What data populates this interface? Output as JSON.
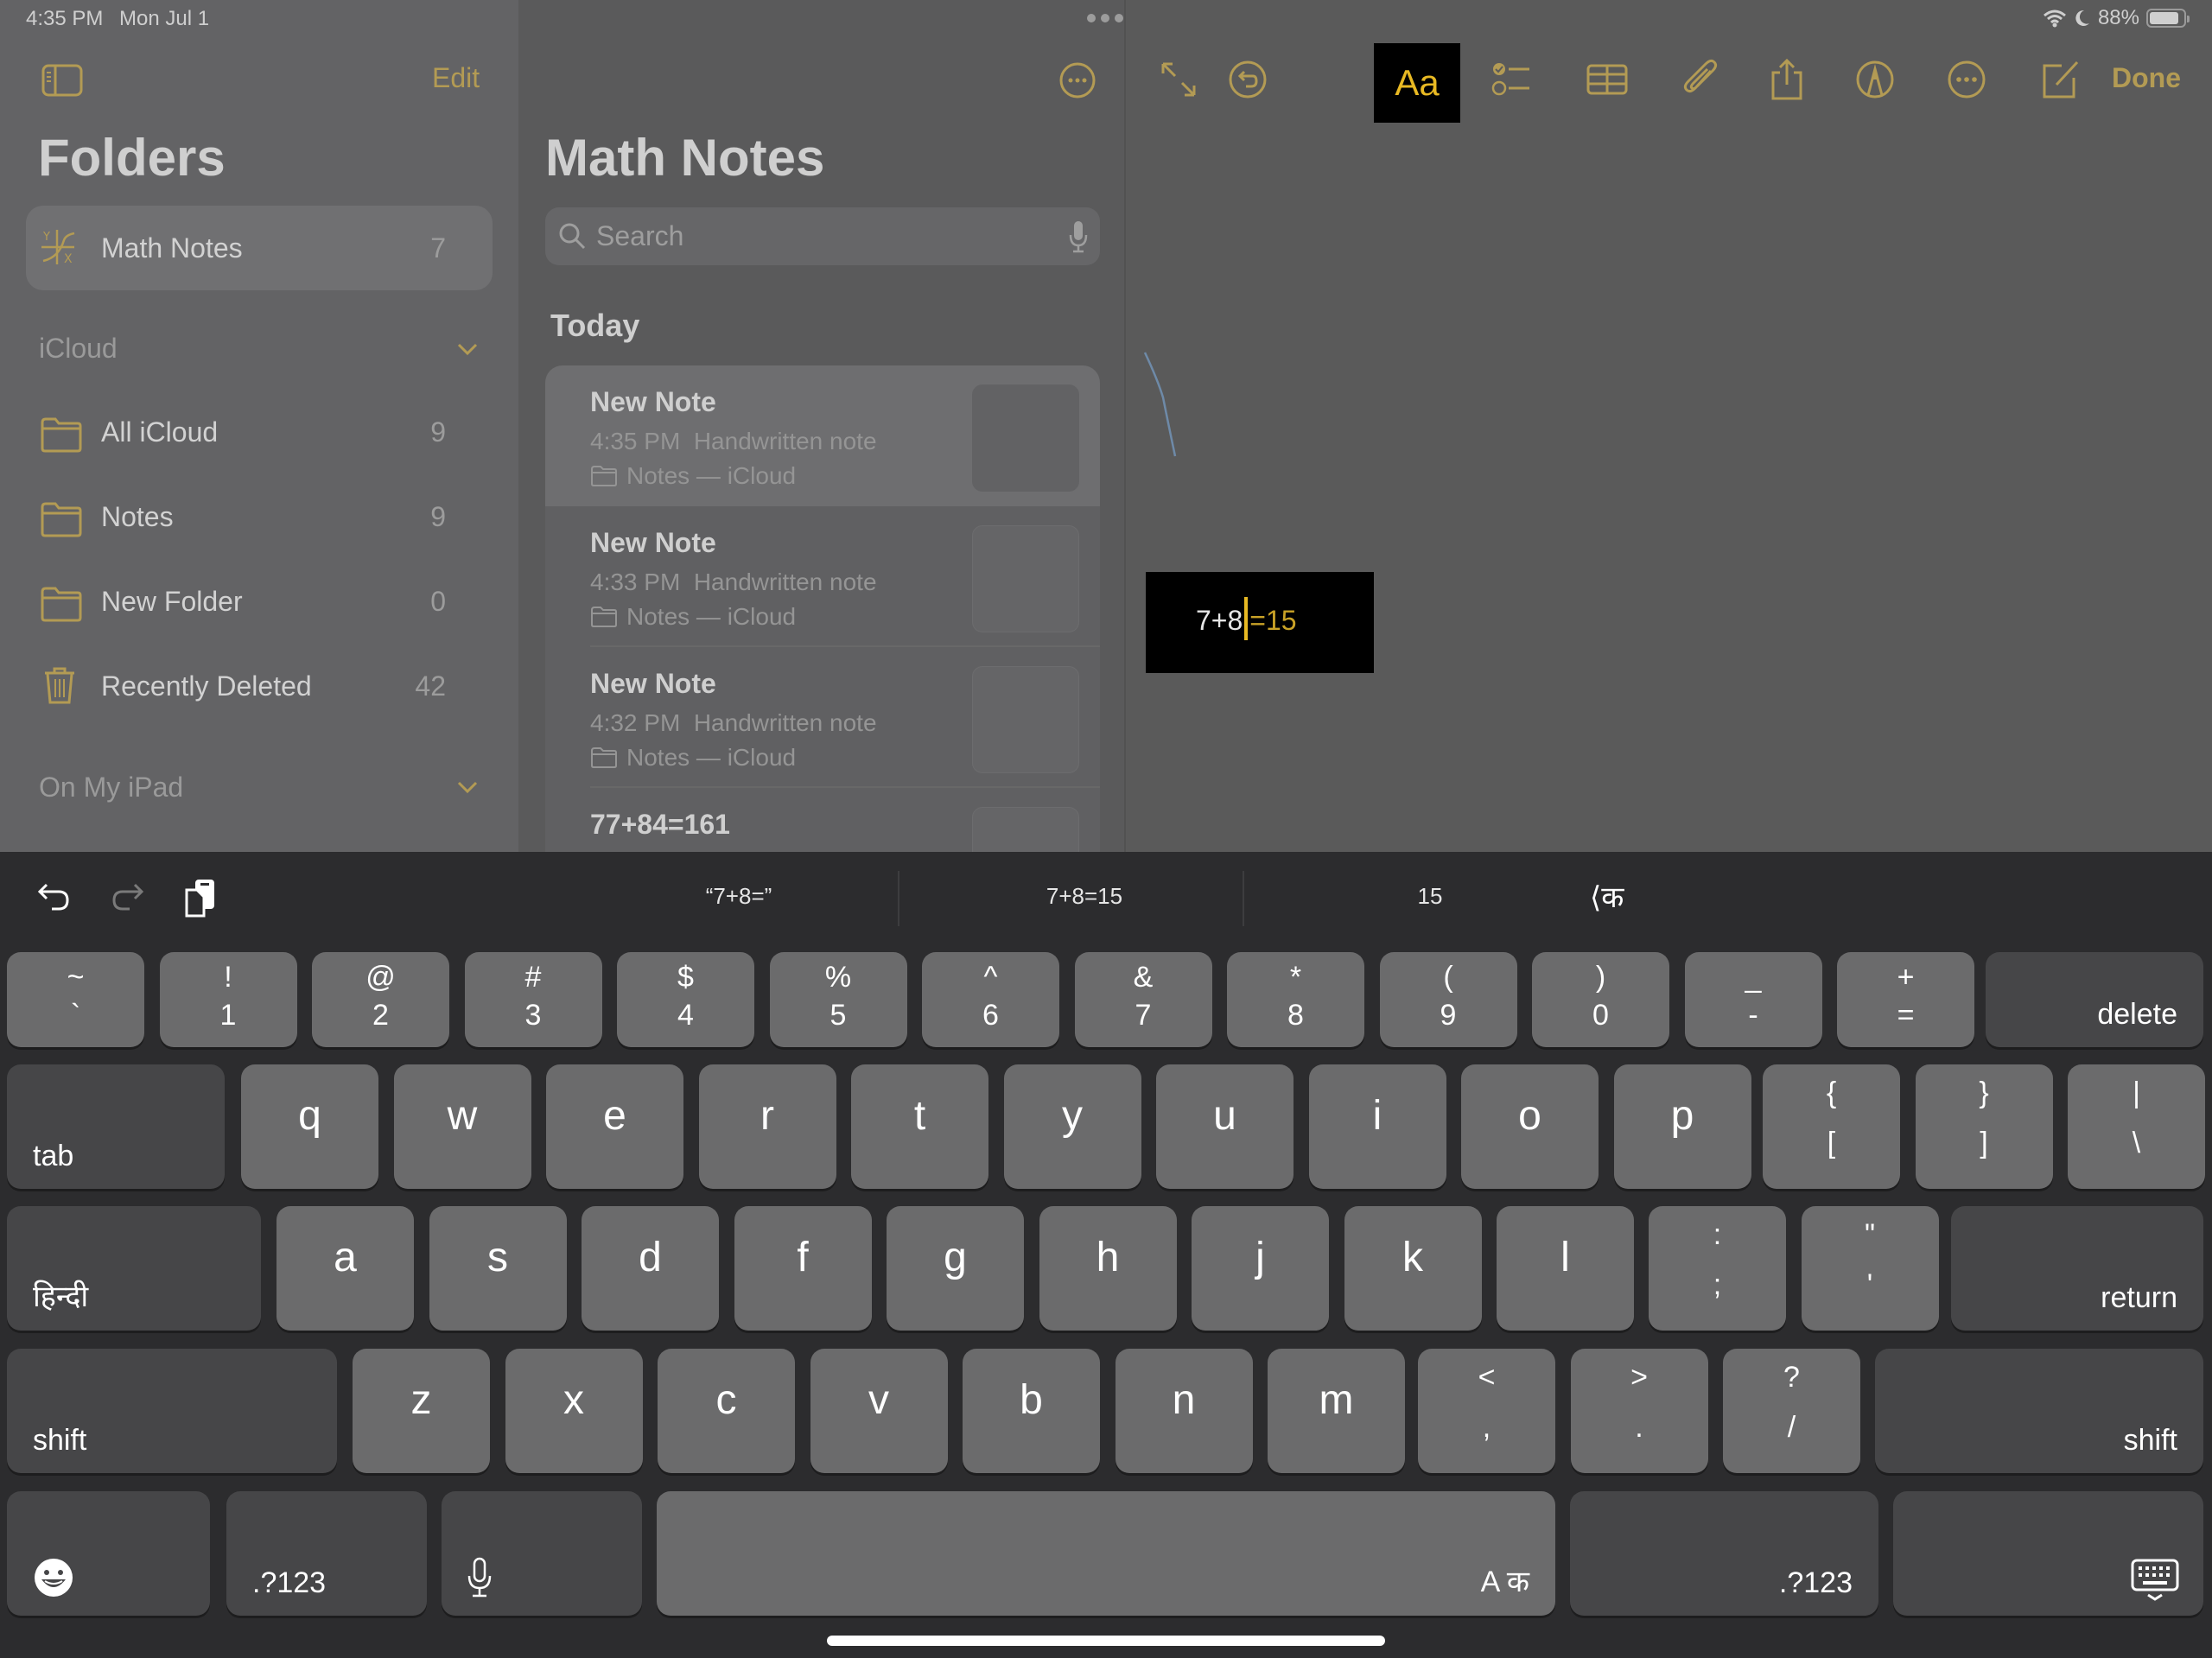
{
  "status_bar": {
    "time": "4:35 PM",
    "date": "Mon Jul 1",
    "battery": "88%",
    "battery_level": 0.88
  },
  "sidebar": {
    "edit_label": "Edit",
    "title": "Folders",
    "pinned": {
      "label": "Math Notes",
      "count": "7",
      "icon": "math-notes-icon"
    },
    "icloud_section": "iCloud",
    "folders": [
      {
        "label": "All iCloud",
        "count": "9",
        "icon": "folder-icon"
      },
      {
        "label": "Notes",
        "count": "9",
        "icon": "folder-icon"
      },
      {
        "label": "New Folder",
        "count": "0",
        "icon": "folder-icon"
      },
      {
        "label": "Recently Deleted",
        "count": "42",
        "icon": "trash-icon"
      }
    ],
    "ipad_section": "On My iPad"
  },
  "notes_list": {
    "title": "Math Notes",
    "search_placeholder": "Search",
    "group_label": "Today",
    "notes": [
      {
        "title": "New Note",
        "meta": "4:35 PM  Handwritten note",
        "folder": "Notes — iCloud"
      },
      {
        "title": "New Note",
        "meta": "4:33 PM  Handwritten note",
        "folder": "Notes — iCloud"
      },
      {
        "title": "New Note",
        "meta": "4:32 PM  Handwritten note",
        "folder": "Notes — iCloud"
      },
      {
        "title": "77+84=161",
        "meta": "",
        "folder": ""
      }
    ]
  },
  "editor": {
    "toolbar": {
      "format_label": "Aa",
      "done_label": "Done"
    },
    "math": {
      "expression": "7+8",
      "result": "=15"
    }
  },
  "keyboard": {
    "suggestions": [
      "“7+8=”",
      "7+8=15",
      "15"
    ],
    "lang_switch": "⟨क",
    "row1": [
      {
        "top": "~",
        "bot": "`"
      },
      {
        "top": "!",
        "bot": "1"
      },
      {
        "top": "@",
        "bot": "2"
      },
      {
        "top": "#",
        "bot": "3"
      },
      {
        "top": "$",
        "bot": "4"
      },
      {
        "top": "%",
        "bot": "5"
      },
      {
        "top": "^",
        "bot": "6"
      },
      {
        "top": "&",
        "bot": "7"
      },
      {
        "top": "*",
        "bot": "8"
      },
      {
        "top": "(",
        "bot": "9"
      },
      {
        "top": ")",
        "bot": "0"
      },
      {
        "top": "_",
        "bot": "-"
      },
      {
        "top": "+",
        "bot": "="
      }
    ],
    "delete": "delete",
    "tab": "tab",
    "row2": [
      "q",
      "w",
      "e",
      "r",
      "t",
      "y",
      "u",
      "i",
      "o",
      "p"
    ],
    "row2_sym": [
      {
        "top": "{",
        "bot": "["
      },
      {
        "top": "}",
        "bot": "]"
      },
      {
        "top": "|",
        "bot": "\\"
      }
    ],
    "hindi": "हिन्दी",
    "row3": [
      "a",
      "s",
      "d",
      "f",
      "g",
      "h",
      "j",
      "k",
      "l"
    ],
    "row3_sym": [
      {
        "top": ":",
        "bot": ";"
      },
      {
        "top": "\"",
        "bot": "'"
      }
    ],
    "return": "return",
    "shift": "shift",
    "row4": [
      "z",
      "x",
      "c",
      "v",
      "b",
      "n",
      "m"
    ],
    "row4_sym": [
      {
        "top": "<",
        "bot": ","
      },
      {
        "top": ">",
        "bot": "."
      },
      {
        "top": "?",
        "bot": "/"
      }
    ],
    "numbers": ".?123",
    "space": "A क"
  },
  "colors": {
    "accent": "#b39b54",
    "accent_bright": "#e8b923"
  }
}
